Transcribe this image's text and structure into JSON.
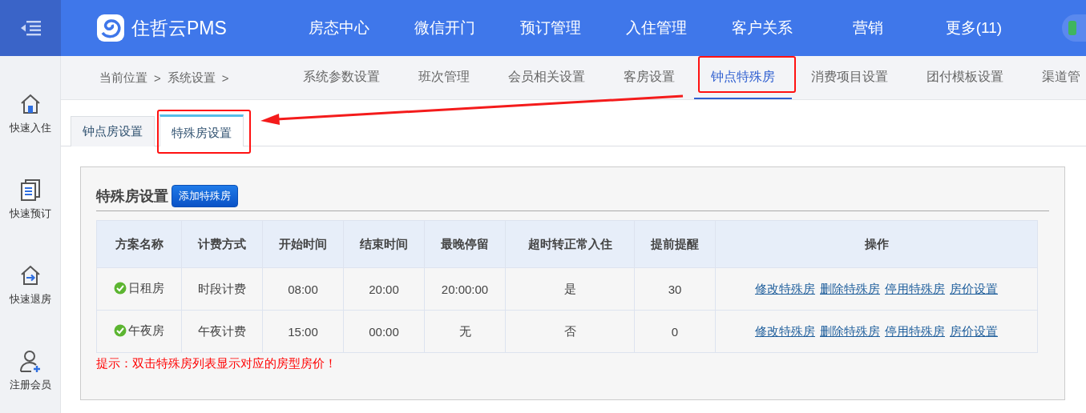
{
  "header": {
    "brand": "住哲云PMS",
    "nav": [
      {
        "label": "房态中心"
      },
      {
        "label": "微信开门"
      },
      {
        "label": "预订管理"
      },
      {
        "label": "入住管理"
      },
      {
        "label": "客户关系"
      },
      {
        "label": "营销"
      },
      {
        "label": "更多(11)"
      }
    ]
  },
  "sidebar": {
    "items": [
      {
        "kind": "home",
        "label": "快速入住"
      },
      {
        "kind": "document",
        "label": "快速预订"
      },
      {
        "kind": "checkout",
        "label": "快速退房"
      },
      {
        "kind": "user-add",
        "label": "注册会员"
      }
    ]
  },
  "breadcrumb": [
    "当前位置",
    ">",
    "系统设置",
    ">"
  ],
  "subnav": [
    {
      "label": "系统参数设置",
      "selected": false
    },
    {
      "label": "班次管理",
      "selected": false
    },
    {
      "label": "会员相关设置",
      "selected": false
    },
    {
      "label": "客房设置",
      "selected": false
    },
    {
      "label": "钟点特殊房",
      "selected": true
    },
    {
      "label": "消费项目设置",
      "selected": false
    },
    {
      "label": "团付模板设置",
      "selected": false
    },
    {
      "label": "渠道管",
      "selected": false
    }
  ],
  "tabs": [
    {
      "label": "钟点房设置",
      "selected": false
    },
    {
      "label": "特殊房设置",
      "selected": true
    }
  ],
  "panel": {
    "title": "特殊房设置",
    "add_button": "添加特殊房",
    "table": {
      "columns": [
        "方案名称",
        "计费方式",
        "开始时间",
        "结束时间",
        "最晚停留",
        "超时转正常入住",
        "提前提醒",
        "操作"
      ],
      "rows": [
        {
          "enabled": true,
          "cells": [
            "日租房",
            "时段计费",
            "08:00",
            "20:00",
            "20:00:00",
            "是",
            "30"
          ],
          "actions": [
            "修改特殊房",
            "删除特殊房",
            "停用特殊房",
            "房价设置"
          ]
        },
        {
          "enabled": true,
          "cells": [
            "午夜房",
            "午夜计费",
            "15:00",
            "00:00",
            "无",
            "否",
            "0"
          ],
          "actions": [
            "修改特殊房",
            "删除特殊房",
            "停用特殊房",
            "房价设置"
          ]
        }
      ]
    },
    "hint": "提示：双击特殊房列表显示对应的房型房价！"
  }
}
